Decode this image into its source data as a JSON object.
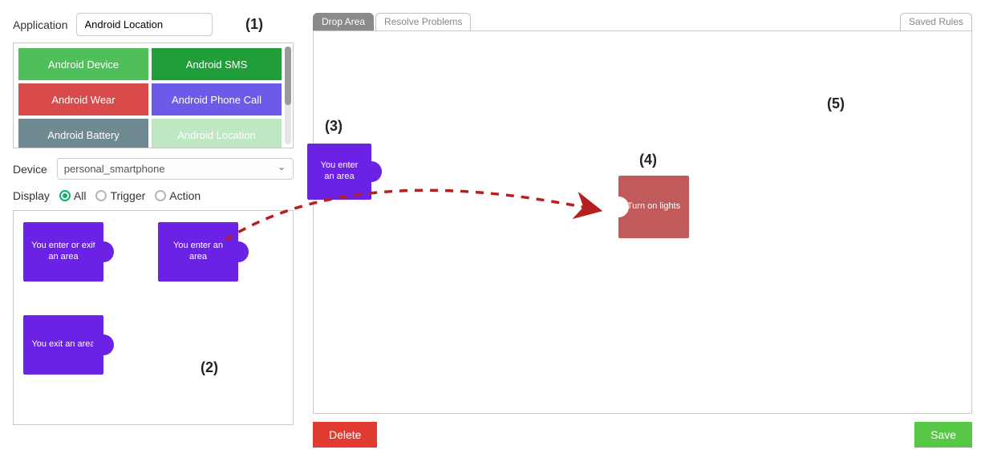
{
  "annotations": {
    "a1": "(1)",
    "a2": "(2)",
    "a3": "(3)",
    "a4": "(4)",
    "a5": "(5)"
  },
  "sidebar": {
    "application_label": "Application",
    "application_value": "Android Location",
    "tiles": [
      {
        "label": "Android Device",
        "color": "#4fbf5a"
      },
      {
        "label": "Android SMS",
        "color": "#1f9e3a"
      },
      {
        "label": "Android Wear",
        "color": "#d94a4a"
      },
      {
        "label": "Android Phone Call",
        "color": "#6d5ae8"
      },
      {
        "label": "Android Battery",
        "color": "#6f8a90"
      },
      {
        "label": "Android Location",
        "color": "#bde8c1"
      }
    ],
    "device_label": "Device",
    "device_value": "personal_smartphone",
    "display_label": "Display",
    "display_options": {
      "all": "All",
      "trigger": "Trigger",
      "action": "Action"
    },
    "display_selected": "all",
    "blocks": [
      {
        "label": "You enter or exit an area"
      },
      {
        "label": "You enter an area"
      },
      {
        "label": "You exit an area"
      }
    ]
  },
  "canvas_tabs": {
    "drop_area": "Drop Area",
    "resolve": "Resolve Problems",
    "saved": "Saved Rules"
  },
  "canvas_blocks": {
    "trigger": "You enter an area",
    "action": "Turn on lights"
  },
  "buttons": {
    "delete": "Delete",
    "save": "Save"
  },
  "colors": {
    "trigger": "#6b22e5",
    "action": "#c05a5b",
    "arrow": "#b71f1f"
  }
}
